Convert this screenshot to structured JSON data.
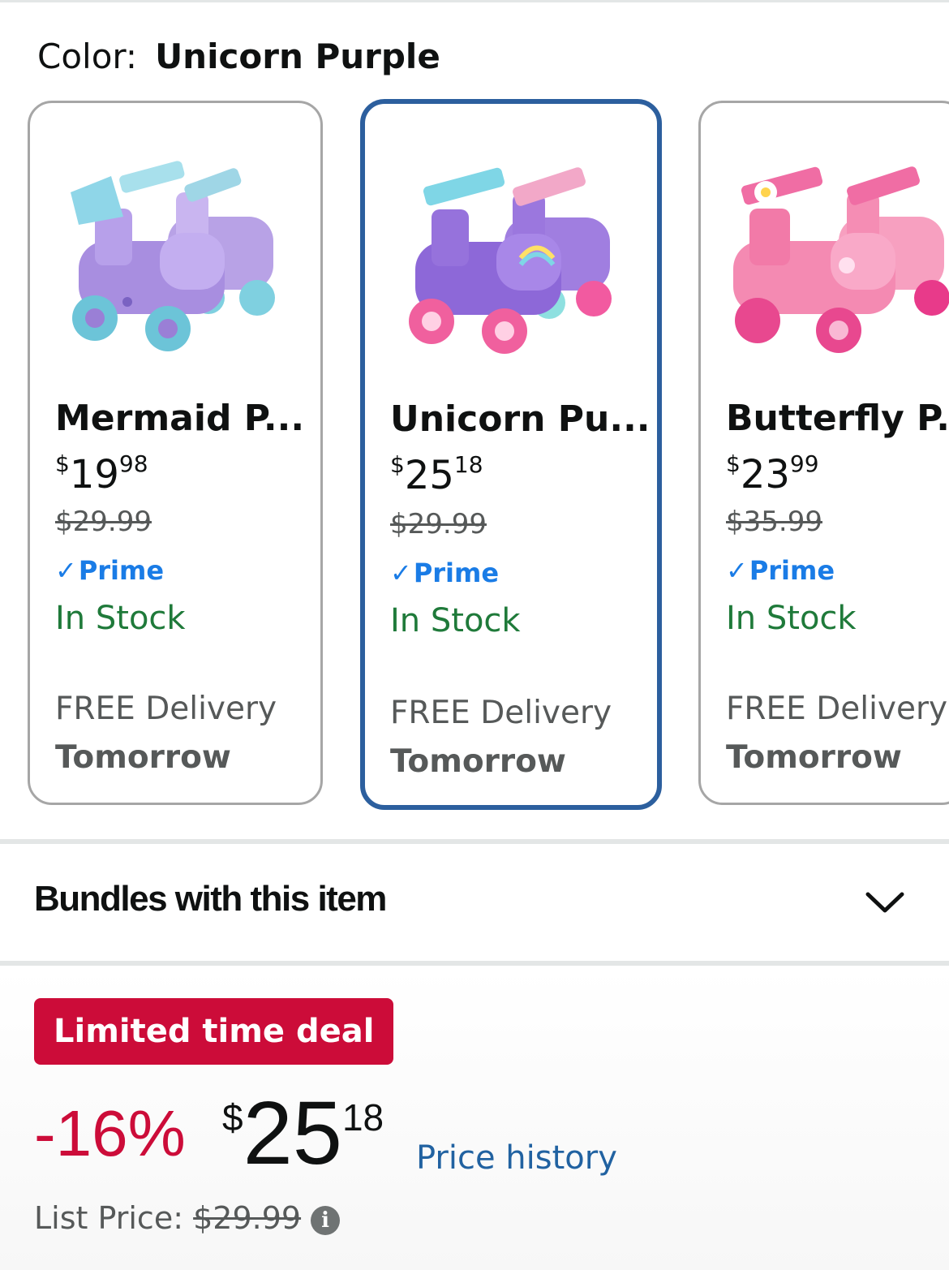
{
  "color_selector": {
    "label": "Color:",
    "value": "Unicorn Purple"
  },
  "variants": [
    {
      "title": "Mermaid P...",
      "price_symbol": "$",
      "price_whole": "19",
      "price_fraction": "98",
      "was_price": "$29.99",
      "prime_check": "✓",
      "prime_label": "Prime",
      "stock": "In Stock",
      "delivery": "FREE Delivery",
      "delivery_when": "Tomorrow",
      "selected": false,
      "image_icon": "mermaid-roller-skates-image"
    },
    {
      "title": "Unicorn Pu...",
      "price_symbol": "$",
      "price_whole": "25",
      "price_fraction": "18",
      "was_price": "$29.99",
      "prime_check": "✓",
      "prime_label": "Prime",
      "stock": "In Stock",
      "delivery": "FREE Delivery",
      "delivery_when": "Tomorrow",
      "selected": true,
      "image_icon": "unicorn-roller-skates-image"
    },
    {
      "title": "Butterfly P...",
      "price_symbol": "$",
      "price_whole": "23",
      "price_fraction": "99",
      "was_price": "$35.99",
      "prime_check": "✓",
      "prime_label": "Prime",
      "stock": "In Stock",
      "delivery": "FREE Delivery",
      "delivery_when": "Tomorrow",
      "selected": false,
      "image_icon": "butterfly-roller-skates-image"
    }
  ],
  "bundles": {
    "label": "Bundles with this item",
    "icon": "chevron-down-icon"
  },
  "deal": {
    "badge": "Limited time deal",
    "discount": "-16%",
    "price_symbol": "$",
    "price_whole": "25",
    "price_fraction": "18",
    "history_link": "Price history",
    "list_price_label": "List Price:",
    "list_price_value": "$29.99",
    "info_icon": "i"
  },
  "colors": {
    "selected_border": "#2c5f9e",
    "card_border": "#a6a6a6",
    "prime_blue": "#1a7ce6",
    "stock_green": "#1f7a3a",
    "deal_red": "#cc0c39",
    "link_blue": "#2162a1"
  }
}
